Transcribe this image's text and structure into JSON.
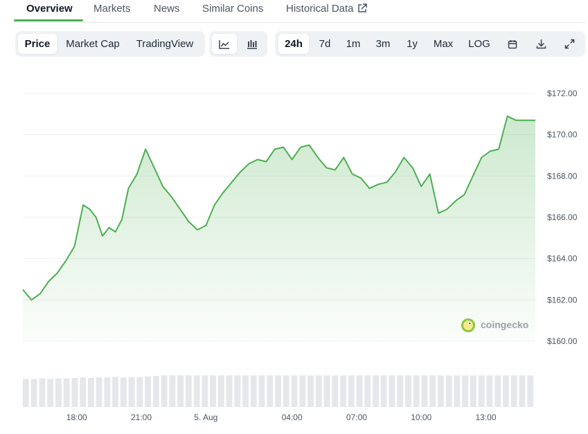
{
  "tabs": [
    {
      "label": "Overview"
    },
    {
      "label": "Markets"
    },
    {
      "label": "News"
    },
    {
      "label": "Similar Coins"
    },
    {
      "label": "Historical Data"
    }
  ],
  "metric_options": [
    "Price",
    "Market Cap",
    "TradingView"
  ],
  "range_options": [
    "24h",
    "7d",
    "1m",
    "3m",
    "1y",
    "Max",
    "LOG"
  ],
  "watermark": "coingecko",
  "colors": {
    "line": "#4caf50",
    "accent": "#4caf50",
    "volume": "#e5e7eb"
  },
  "chart_data": {
    "type": "area",
    "title": "",
    "xlabel": "",
    "ylabel": "",
    "ylim": [
      160,
      172
    ],
    "xlim": [
      15.5,
      39.3
    ],
    "y_ticks": [
      172,
      170,
      168,
      166,
      164,
      162,
      160
    ],
    "y_tick_labels": [
      "$172.00",
      "$170.00",
      "$168.00",
      "$166.00",
      "$164.00",
      "$162.00",
      "$160.00"
    ],
    "x_ticks": [
      18,
      21,
      24,
      28,
      31,
      34,
      37
    ],
    "x_tick_labels": [
      "18:00",
      "21:00",
      "5. Aug",
      "04:00",
      "07:00",
      "10:00",
      "13:00"
    ],
    "grid": true,
    "series": [
      {
        "x": [
          15.5,
          15.9,
          16.3,
          16.7,
          17.1,
          17.5,
          17.9,
          18.3,
          18.6,
          18.9,
          19.2,
          19.5,
          19.8,
          20.1,
          20.4,
          20.8,
          21.2,
          21.6,
          22.0,
          22.4,
          22.8,
          23.2,
          23.6,
          24.0,
          24.4,
          24.8,
          25.2,
          25.6,
          26.0,
          26.4,
          26.8,
          27.2,
          27.6,
          28.0,
          28.4,
          28.8,
          29.2,
          29.6,
          30.0,
          30.4,
          30.8,
          31.2,
          31.6,
          32.0,
          32.4,
          32.8,
          33.2,
          33.6,
          34.0,
          34.4,
          34.8,
          35.2,
          35.6,
          36.0,
          36.4,
          36.8,
          37.2,
          37.6,
          38.0,
          38.4,
          38.8,
          39.0,
          39.3
        ],
        "values": [
          162.5,
          162.0,
          162.3,
          162.9,
          163.3,
          163.9,
          164.6,
          166.6,
          166.4,
          166.0,
          165.1,
          165.5,
          165.3,
          165.9,
          167.4,
          168.1,
          169.3,
          168.4,
          167.5,
          167.0,
          166.4,
          165.8,
          165.4,
          165.6,
          166.6,
          167.2,
          167.7,
          168.2,
          168.6,
          168.8,
          168.7,
          169.3,
          169.4,
          168.8,
          169.4,
          169.5,
          168.9,
          168.4,
          168.3,
          168.9,
          168.1,
          167.9,
          167.4,
          167.6,
          167.7,
          168.2,
          168.9,
          168.4,
          167.5,
          168.1,
          166.2,
          166.4,
          166.8,
          167.1,
          168.0,
          168.9,
          169.2,
          169.3,
          170.9,
          170.7,
          170.7,
          170.7,
          170.7
        ]
      }
    ],
    "volume": [
      0.55,
      0.55,
      0.56,
      0.55,
      0.56,
      0.56,
      0.57,
      0.58,
      0.57,
      0.58,
      0.58,
      0.59,
      0.58,
      0.59,
      0.59,
      0.6,
      0.61,
      0.62,
      0.62,
      0.62,
      0.62,
      0.62,
      0.62,
      0.62,
      0.62,
      0.62,
      0.62,
      0.62,
      0.62,
      0.62,
      0.62,
      0.62,
      0.62,
      0.62,
      0.62,
      0.62,
      0.62,
      0.62,
      0.62,
      0.62,
      0.62,
      0.62,
      0.62,
      0.62,
      0.62,
      0.62,
      0.62,
      0.62,
      0.62,
      0.62,
      0.62,
      0.62,
      0.62,
      0.62,
      0.62,
      0.62,
      0.62,
      0.62,
      0.62,
      0.62,
      0.62,
      0.62,
      0.62
    ]
  }
}
